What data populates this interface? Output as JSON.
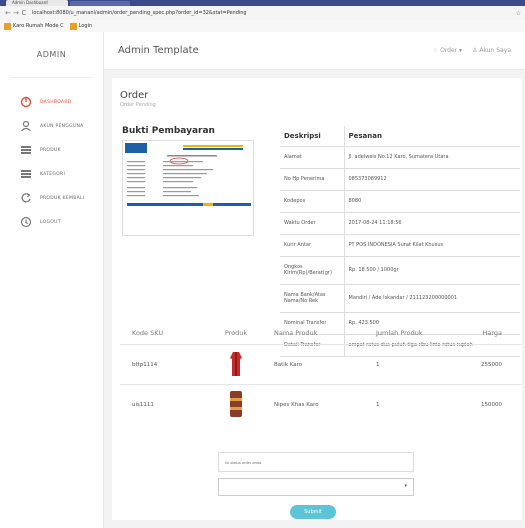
{
  "browser": {
    "tab_title": "Admin Dashboard",
    "url": "localhost:8080/u_manani/admin/order_pending_spec.php?order_id=32&stat=Pending",
    "bookmarks": [
      "Karo Rumah Mode C",
      "Login"
    ]
  },
  "sidebar": {
    "brand": "ADMIN",
    "items": [
      {
        "label": "DASHBOARD",
        "icon": "dashboard-icon",
        "active": true
      },
      {
        "label": "AKUN PENGGUNA",
        "icon": "user-icon",
        "active": false
      },
      {
        "label": "PRODUK",
        "icon": "product-icon",
        "active": false
      },
      {
        "label": "KATEGORI",
        "icon": "category-icon",
        "active": false
      },
      {
        "label": "PRODUK KEMBALI",
        "icon": "return-icon",
        "active": false
      },
      {
        "label": "LOGOUT",
        "icon": "logout-icon",
        "active": false
      }
    ]
  },
  "topbar": {
    "title": "Admin Template",
    "order_label": "Order",
    "account_label": "Akun Saya"
  },
  "page": {
    "title": "Order",
    "subtitle": "Order Pending"
  },
  "bukti": {
    "title": "Bukti Pembayaran"
  },
  "details": {
    "header_left": "Deskripsi",
    "header_right": "Pesanan",
    "rows": [
      {
        "k": "Alamat",
        "v": "Jl. adelweis No.12 Karo, Sumatera Utara"
      },
      {
        "k": "No Hp Penerima",
        "v": "085373089912"
      },
      {
        "k": "Kodepos",
        "v": "8080"
      },
      {
        "k": "Waktu Order",
        "v": "2017-08-24 11:18:56"
      },
      {
        "k": "Kurir Antar",
        "v": "PT POS INDONESIA Surat Kilat Khusus"
      },
      {
        "k": "Ongkos Kirim(Rp)/Berat(gr)",
        "v": "Rp. 18.500 / 1000gr"
      },
      {
        "k": "Nama Bank/Atas Nama/No Rek",
        "v": "Mandiri / Ade Iskandar / 211123200000001"
      },
      {
        "k": "Nominal Transfer",
        "v": "Rp. 423.500"
      },
      {
        "k": "Detail Transfer",
        "v": "empat ratus dua puluh tiga ribu lima ratus rupiah"
      }
    ]
  },
  "products": {
    "headers": [
      "Kode SKU",
      "Produk",
      "Nama Produk",
      "Jumlah Produk",
      "Harga"
    ],
    "rows": [
      {
        "sku": "bttp1114",
        "name": "Batik Karo",
        "qty": "1",
        "price": "255000",
        "color": "#c62828"
      },
      {
        "sku": "uis1111",
        "name": "Nipes Khas Karo",
        "qty": "1",
        "price": "150000",
        "color": "#8d3b2a"
      }
    ]
  },
  "form": {
    "input_placeholder": "Isi status order anda",
    "select_value": "",
    "submit_label": "Submit"
  }
}
